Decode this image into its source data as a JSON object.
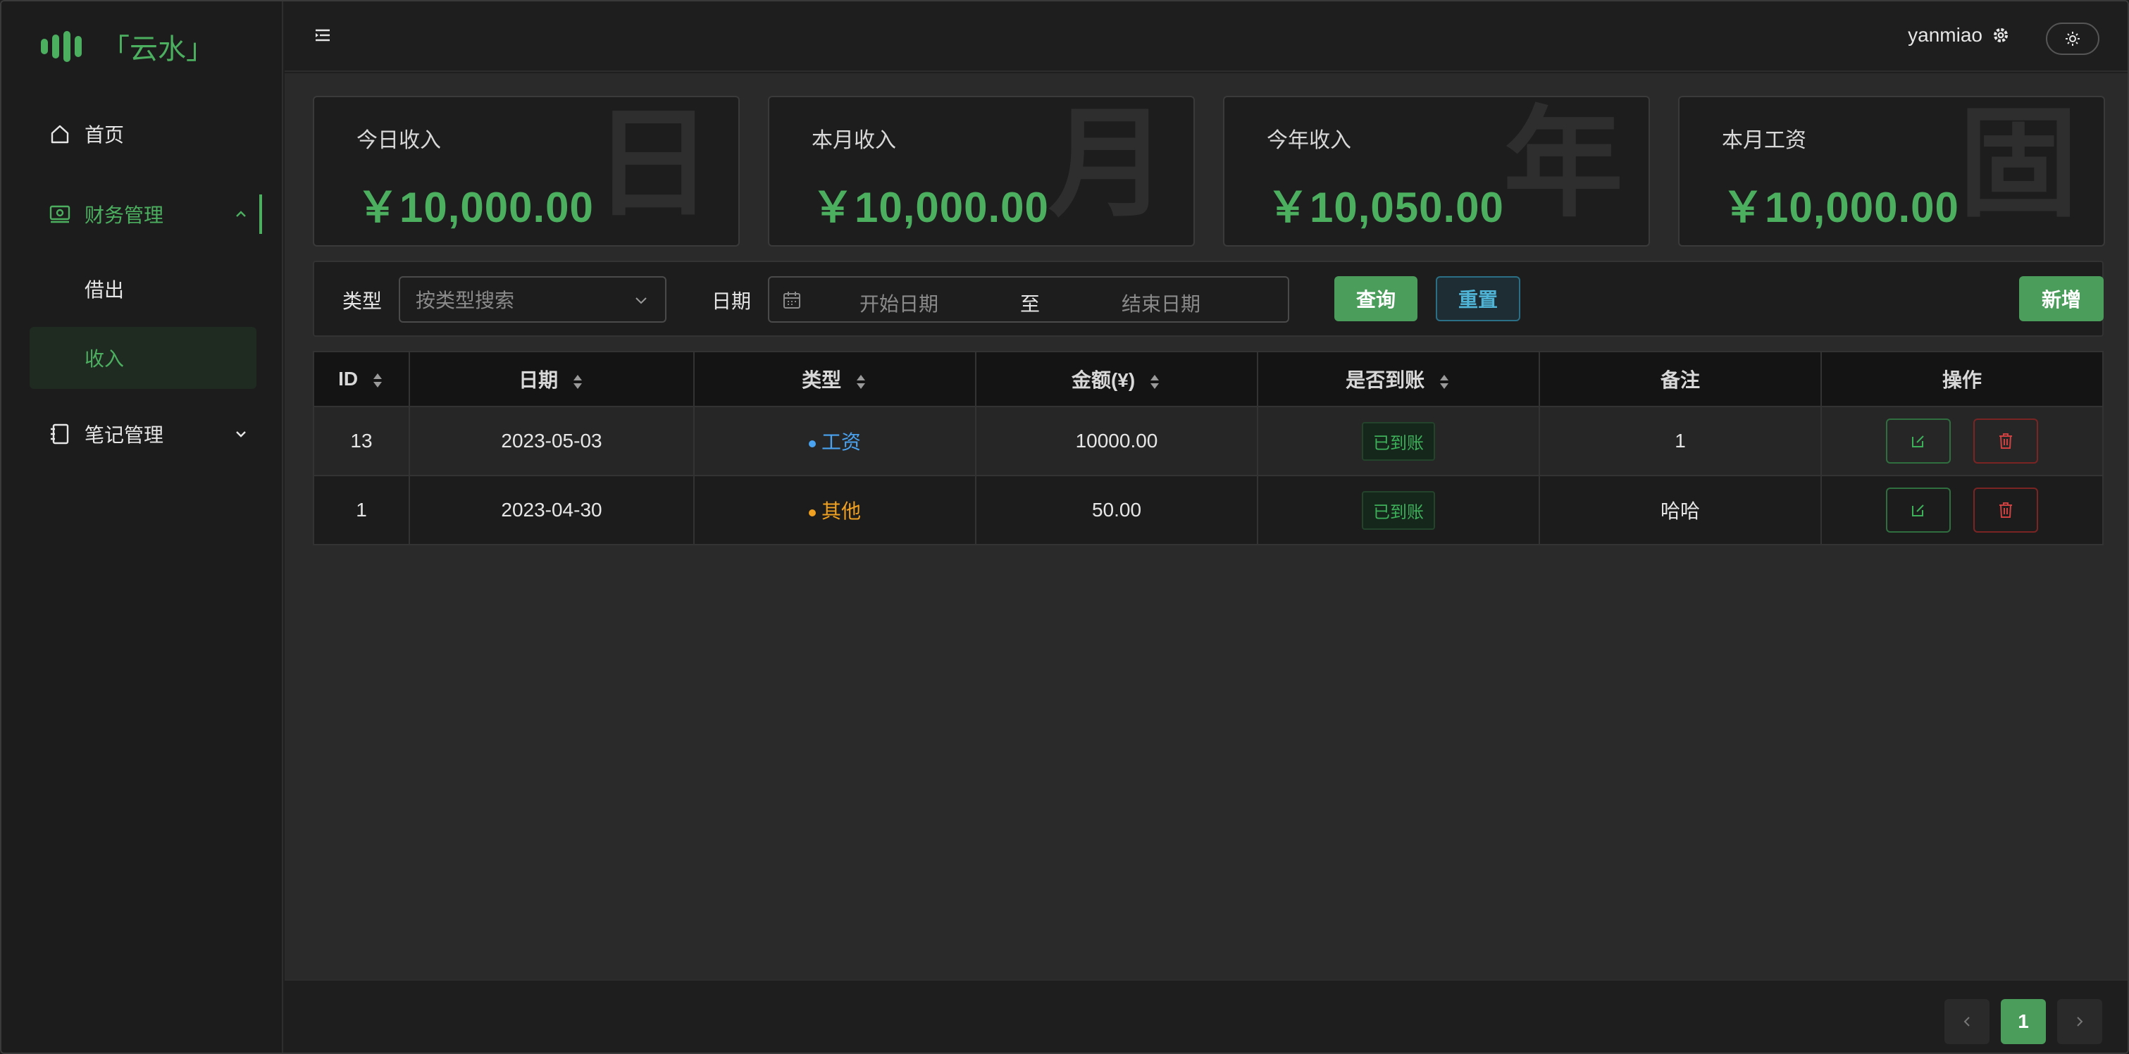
{
  "brand": {
    "title": "「云水」",
    "color": "#4caf60"
  },
  "sidebar": {
    "items": [
      {
        "label": "首页",
        "icon": "home-icon"
      },
      {
        "label": "财务管理",
        "icon": "finance-icon",
        "expanded": true
      },
      {
        "label": "借出"
      },
      {
        "label": "收入",
        "active": true
      },
      {
        "label": "笔记管理",
        "icon": "notebook-icon",
        "expanded": false
      }
    ]
  },
  "header": {
    "username": "yanmiao"
  },
  "cards": [
    {
      "label": "今日收入",
      "value": "￥10,000.00",
      "bg_char": "日"
    },
    {
      "label": "本月收入",
      "value": "￥10,000.00",
      "bg_char": "月"
    },
    {
      "label": "今年收入",
      "value": "￥10,050.00",
      "bg_char": "年"
    },
    {
      "label": "本月工资",
      "value": "￥10,000.00",
      "bg_char": "固"
    }
  ],
  "filter": {
    "type_label": "类型",
    "type_placeholder": "按类型搜索",
    "date_label": "日期",
    "start_placeholder": "开始日期",
    "separator": "至",
    "end_placeholder": "结束日期",
    "query": "查询",
    "reset": "重置",
    "add": "新增"
  },
  "table": {
    "columns": [
      "ID",
      "日期",
      "类型",
      "金额(¥)",
      "是否到账",
      "备注",
      "操作"
    ],
    "rows": [
      {
        "id": "13",
        "date": "2023-05-03",
        "type": "工资",
        "type_color": "#4aa3f0",
        "amount": "10000.00",
        "status": "已到账",
        "note": "1"
      },
      {
        "id": "1",
        "date": "2023-04-30",
        "type": "其他",
        "type_color": "#f0a020",
        "amount": "50.00",
        "status": "已到账",
        "note": "哈哈"
      }
    ]
  },
  "pagination": {
    "current": "1"
  }
}
